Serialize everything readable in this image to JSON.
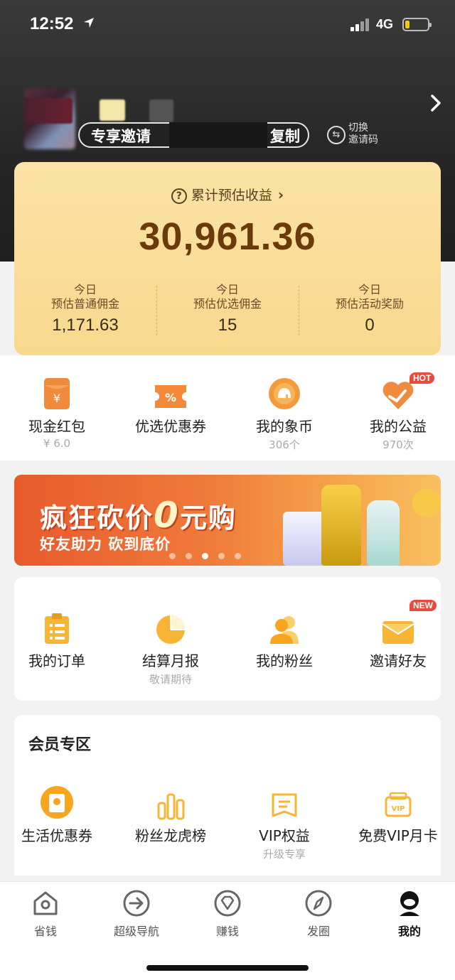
{
  "status_bar": {
    "time": "12:52",
    "network": "4G"
  },
  "profile": {
    "invite_label": "专享邀请",
    "copy_label": "复制",
    "switch_label_1": "切换",
    "switch_label_2": "邀请码"
  },
  "earnings": {
    "title": "累计预估收益",
    "total": "30,961.36",
    "columns": [
      {
        "day": "今日",
        "title": "预估普通佣金",
        "value": "1,171.63"
      },
      {
        "day": "今日",
        "title": "预估优选佣金",
        "value": "15"
      },
      {
        "day": "今日",
        "title": "预估活动奖励",
        "value": "0"
      }
    ]
  },
  "quick": [
    {
      "label": "现金红包",
      "sub": "¥ 6.0",
      "icon": "red-packet-icon"
    },
    {
      "label": "优选优惠券",
      "sub": "",
      "icon": "coupon-icon"
    },
    {
      "label": "我的象币",
      "sub": "306个",
      "icon": "elephant-coin-icon"
    },
    {
      "label": "我的公益",
      "sub": "970次",
      "icon": "charity-heart-icon",
      "badge": "HOT"
    }
  ],
  "banner": {
    "title_1": "疯狂砍价",
    "zero": "0",
    "title_2": "元购",
    "subtitle": "好友助力 砍到底价",
    "dots": 5,
    "active_dot": 3
  },
  "tools": [
    {
      "label": "我的订单",
      "sub": "",
      "icon": "order-list-icon"
    },
    {
      "label": "结算月报",
      "sub": "敬请期待",
      "icon": "pie-chart-icon"
    },
    {
      "label": "我的粉丝",
      "sub": "",
      "icon": "fans-icon"
    },
    {
      "label": "邀请好友",
      "sub": "",
      "icon": "invite-envelope-icon",
      "badge": "NEW"
    }
  ],
  "member": {
    "title": "会员专区",
    "items": [
      {
        "label": "生活优惠券",
        "sub": "",
        "icon": "life-coupon-icon"
      },
      {
        "label": "粉丝龙虎榜",
        "sub": "",
        "icon": "bar-ranking-icon"
      },
      {
        "label": "VIP权益",
        "sub": "升级专享",
        "icon": "vip-rights-icon"
      },
      {
        "label": "免费VIP月卡",
        "sub": "",
        "icon": "vip-card-icon"
      }
    ]
  },
  "tabs": [
    {
      "label": "省钱",
      "icon": "home-icon"
    },
    {
      "label": "超级导航",
      "icon": "navigate-arrow-icon"
    },
    {
      "label": "赚钱",
      "icon": "diamond-icon"
    },
    {
      "label": "发圈",
      "icon": "compass-icon"
    },
    {
      "label": "我的",
      "icon": "profile-icon",
      "active": true
    }
  ],
  "colors": {
    "accent": "#f7a51c",
    "card_gold": "#f9dd96",
    "total_text": "#6a3a0a",
    "badge_red": "#e84b3c"
  }
}
